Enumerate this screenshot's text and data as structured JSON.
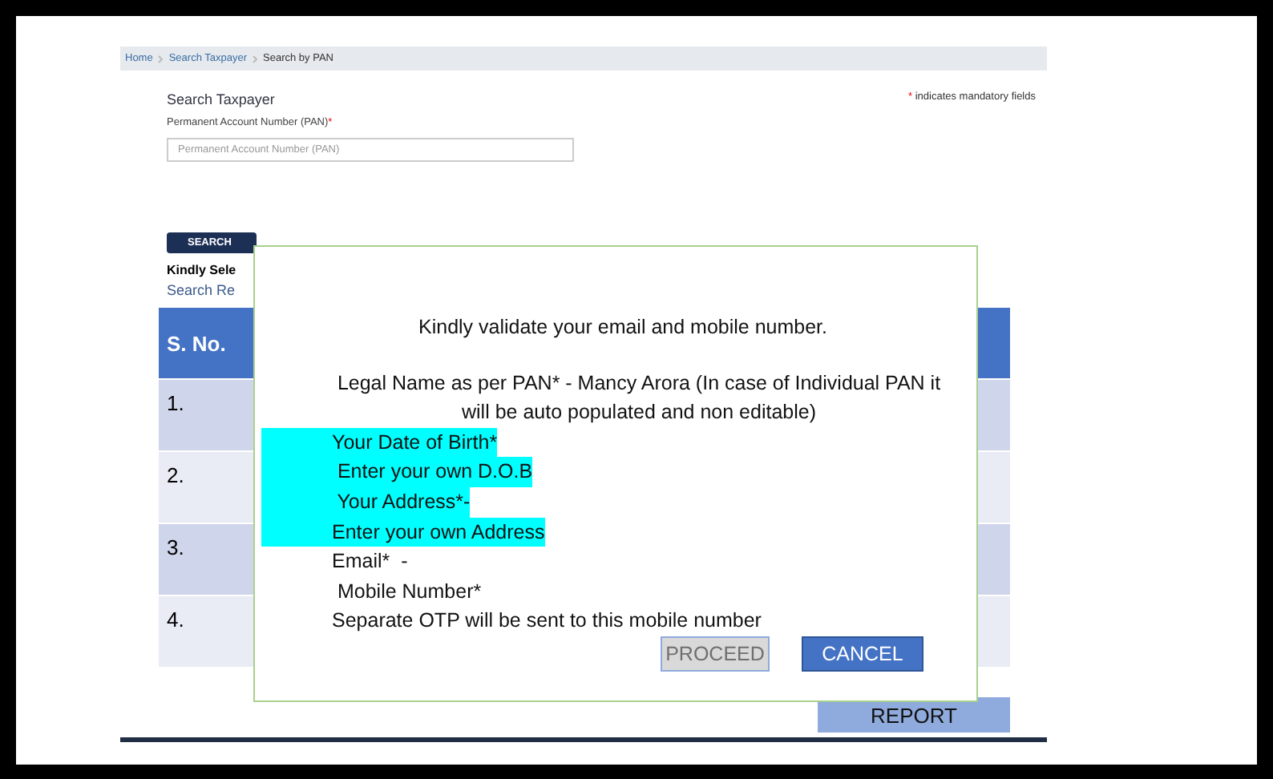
{
  "breadcrumb": [
    {
      "label": "Home",
      "current": false
    },
    {
      "label": "Search Taxpayer",
      "current": false
    },
    {
      "label": "Search by PAN",
      "current": true
    }
  ],
  "form": {
    "title": "Search Taxpayer",
    "mandatory_note": "indicates mandatory fields",
    "mandatory_mark": "*",
    "field_label": "Permanent Account Number (PAN)",
    "field_placeholder": "Permanent Account Number (PAN)",
    "search_button": "SEARCH",
    "instruction": "Kindly Sele",
    "results_title": "Search Re"
  },
  "table": {
    "columns": [
      "S. No."
    ],
    "rows": [
      {
        "cells": [
          "1."
        ]
      },
      {
        "cells": [
          "2."
        ]
      },
      {
        "cells": [
          "3."
        ]
      },
      {
        "cells": [
          "4."
        ]
      }
    ]
  },
  "report_button": "REPORT",
  "dialog": {
    "lines": [
      {
        "kind": "heading",
        "text": "Kindly validate your email and mobile number.",
        "highlighted": false
      },
      {
        "kind": "paragraph",
        "text": "Legal Name as per PAN* - Mancy Arora (In case of Individual PAN it will be auto populated and non editable)",
        "highlighted": false
      },
      {
        "kind": "field",
        "text": "Your Date of Birth*",
        "highlighted": true
      },
      {
        "kind": "field",
        "text": " Enter your own D.O.B",
        "highlighted": true
      },
      {
        "kind": "field",
        "text": " Your Address*-",
        "highlighted": true
      },
      {
        "kind": "field",
        "text": "Enter your own Address",
        "highlighted": true
      },
      {
        "kind": "field",
        "text": "Email*  -",
        "highlighted": false
      },
      {
        "kind": "field",
        "text": " Mobile Number*",
        "highlighted": false
      },
      {
        "kind": "field",
        "text": "Separate OTP will be sent to this mobile number",
        "highlighted": false
      }
    ],
    "buttons": [
      {
        "label": "PROCEED",
        "disabled": true
      },
      {
        "label": "CANCEL",
        "disabled": false
      }
    ]
  }
}
